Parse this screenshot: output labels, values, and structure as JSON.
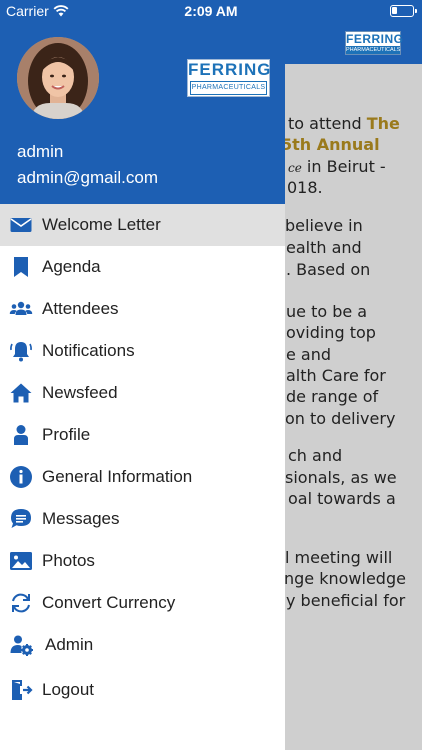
{
  "status_bar": {
    "carrier": "Carrier",
    "time": "2:09 AM"
  },
  "brand": {
    "logo_name": "FERRING",
    "logo_tagline": "PHARMACEUTICALS",
    "primary_color": "#1d5fb3",
    "accent_color": "#1d72b8"
  },
  "background_page": {
    "lines": [
      {
        "pre": "to attend ",
        "highlight": "The",
        "post": "",
        "small": ""
      },
      {
        "pre": "",
        "highlight": "5th Annual",
        "post": "",
        "small": ""
      },
      {
        "pre": "",
        "highlight": "",
        "post": " in Beirut -",
        "small": "ce"
      },
      {
        "pre": "018.",
        "highlight": "",
        "post": "",
        "small": ""
      },
      {
        "pre": " believe in",
        "highlight": "",
        "post": "",
        "small": ""
      },
      {
        "pre": "ealth and",
        "highlight": "",
        "post": "",
        "small": ""
      },
      {
        "pre": ". Based on",
        "highlight": "",
        "post": "",
        "small": ""
      },
      {
        "pre": "ue to be a",
        "highlight": "",
        "post": "",
        "small": ""
      },
      {
        "pre": "oviding top",
        "highlight": "",
        "post": "",
        "small": ""
      },
      {
        "pre": "e and",
        "highlight": "",
        "post": "",
        "small": ""
      },
      {
        "pre": "alth Care for",
        "highlight": "",
        "post": "",
        "small": ""
      },
      {
        "pre": "de range of",
        "highlight": "",
        "post": "",
        "small": ""
      },
      {
        "pre": "on to delivery",
        "highlight": "",
        "post": "",
        "small": ""
      },
      {
        "pre": "ch and",
        "highlight": "",
        "post": "",
        "small": ""
      },
      {
        "pre": "sionals, as we",
        "highlight": "",
        "post": "",
        "small": ""
      },
      {
        "pre": "oal towards a",
        "highlight": "",
        "post": "",
        "small": ""
      },
      {
        "pre": "l meeting will",
        "highlight": "",
        "post": "",
        "small": ""
      },
      {
        "pre": "nge knowledge",
        "highlight": "",
        "post": "",
        "small": ""
      },
      {
        "pre": "y beneficial for",
        "highlight": "",
        "post": "",
        "small": ""
      }
    ]
  },
  "drawer": {
    "user": {
      "name": "admin",
      "email": "admin@gmail.com"
    },
    "menu": [
      {
        "label": "Welcome Letter",
        "icon": "envelope-icon",
        "active": true
      },
      {
        "label": "Agenda",
        "icon": "bookmark-icon",
        "active": false
      },
      {
        "label": "Attendees",
        "icon": "people-icon",
        "active": false
      },
      {
        "label": "Notifications",
        "icon": "bell-icon",
        "active": false
      },
      {
        "label": "Newsfeed",
        "icon": "home-icon",
        "active": false
      },
      {
        "label": "Profile",
        "icon": "person-icon",
        "active": false
      },
      {
        "label": "General Information",
        "icon": "info-icon",
        "active": false
      },
      {
        "label": "Messages",
        "icon": "chat-icon",
        "active": false
      },
      {
        "label": "Photos",
        "icon": "photo-icon",
        "active": false
      },
      {
        "label": "Convert Currency",
        "icon": "refresh-icon",
        "active": false
      },
      {
        "label": "Admin",
        "icon": "admin-gear-icon",
        "active": false
      },
      {
        "label": "Logout",
        "icon": "logout-icon",
        "active": false
      }
    ]
  }
}
